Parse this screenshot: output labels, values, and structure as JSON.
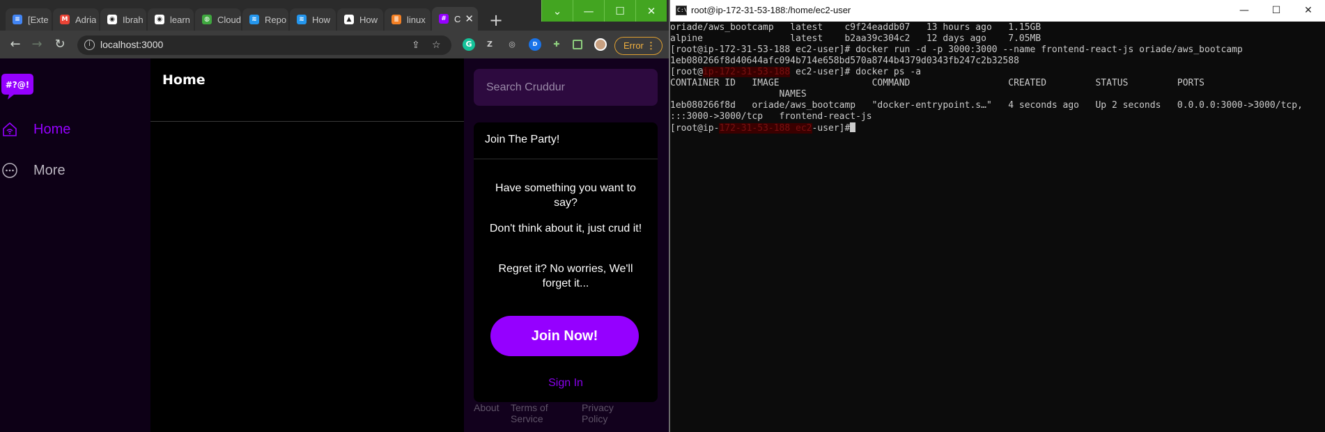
{
  "browser": {
    "tabs": [
      {
        "label": "[Exte",
        "icon": "google-docs-icon",
        "color": "#4285f4"
      },
      {
        "label": "Adria",
        "icon": "gmail-icon",
        "color": "#ea4335"
      },
      {
        "label": "Ibrah",
        "icon": "github-icon",
        "color": "#ffffff"
      },
      {
        "label": "learn",
        "icon": "github-icon",
        "color": "#ffffff"
      },
      {
        "label": "Cloud",
        "icon": "globe-icon",
        "color": "#3fa83f"
      },
      {
        "label": "Repo",
        "icon": "docker-icon",
        "color": "#2496ed"
      },
      {
        "label": "How",
        "icon": "docker-icon",
        "color": "#2496ed"
      },
      {
        "label": "How",
        "icon": "linux-icon",
        "color": "#ffffff"
      },
      {
        "label": "linux",
        "icon": "stackoverflow-icon",
        "color": "#f48024"
      },
      {
        "label": "C",
        "icon": "cruddur-icon",
        "color": "#9500ff"
      }
    ],
    "active_tab_close": "✕",
    "new_tab": "+",
    "url": "localhost:3000",
    "error_label": "Error",
    "window_buttons": [
      "⌄",
      "—",
      "☐",
      "✕"
    ]
  },
  "cruddur": {
    "logo_text": "#?@!",
    "nav": [
      {
        "label": "Home",
        "icon": "home-icon"
      },
      {
        "label": "More",
        "icon": "more-icon"
      }
    ],
    "feed_title": "Home",
    "search_placeholder": "Search Cruddur",
    "join": {
      "title": "Join The Party!",
      "line1": "Have something you want to say?",
      "line2": "Don't think about it, just crud it!",
      "line3": "Regret it? No worries, We'll forget it...",
      "join_button": "Join Now!",
      "sign_in": "Sign In"
    },
    "footer": {
      "about": "About",
      "terms": "Terms of Service",
      "privacy": "Privacy Policy"
    },
    "accent": "#9500ff"
  },
  "terminal": {
    "title": "root@ip-172-31-53-188:/home/ec2-user",
    "lines": [
      "oriade/aws_bootcamp   latest    c9f24eaddb07   13 hours ago   1.15GB",
      "alpine                latest    b2aa39c304c2   12 days ago    7.05MB",
      "[root@ip-172-31-53-188 ec2-user]# docker run -d -p 3000:3000 --name frontend-react-js oriade/aws_bootcamp",
      "1eb080266f8d40644afc094b714e658bd570a8744b4379d0343fb247c2b32588",
      "[root@",
      "CONTAINER ID   IMAGE                 COMMAND                  CREATED         STATUS         PORTS",
      "                    NAMES",
      "1eb080266f8d   oriade/aws_bootcamp   \"docker-entrypoint.s…\"   4 seconds ago   Up 2 seconds   0.0.0.0:3000->3000/tcp,",
      ":::3000->3000/tcp   frontend-react-js",
      "[root@ip-"
    ],
    "line5_suffix": " ec2-user]# docker ps -a",
    "line10_suffix": "-user]#"
  }
}
